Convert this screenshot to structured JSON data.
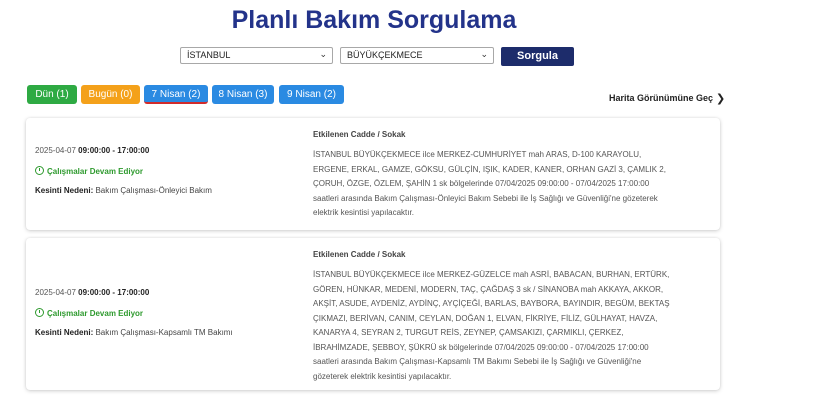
{
  "page": {
    "title": "Planlı Bakım Sorgulama"
  },
  "search": {
    "province": "İSTANBUL",
    "district": "BÜYÜKÇEKMECE",
    "button_label": "Sorgula"
  },
  "tabs": [
    {
      "label": "Dün (1)",
      "color": "#2eaa43"
    },
    {
      "label": "Bugün (0)",
      "color": "#f4a11a"
    },
    {
      "label": "7 Nisan (2)",
      "color": "#2a8ae2",
      "active": true
    },
    {
      "label": "8 Nisan (3)",
      "color": "#2a8ae2"
    },
    {
      "label": "9 Nisan (2)",
      "color": "#2a8ae2"
    }
  ],
  "map_link": "Harita Görünümüne Geç",
  "labels": {
    "reason": "Kesinti Nedeni:",
    "affected": "Etkilenen Cadde / Sokak"
  },
  "outages": [
    {
      "date": "2025-04-07",
      "time": "09:00:00 - 17:00:00",
      "status": "Çalışmalar Devam Ediyor",
      "reason": "Bakım Çalışması-Önleyici Bakım",
      "affected": "İSTANBUL BÜYÜKÇEKMECE ilce MERKEZ-CUMHURİYET mah ARAS, D-100 KARAYOLU, ERGENE, ERKAL, GAMZE, GÖKSU, GÜLÇİN, IŞIK, KADER, KANER, ORHAN GAZİ 3, ÇAMLIK 2, ÇORUH, ÖZGE, ÖZLEM, ŞAHİN 1 sk bölgelerinde 07/04/2025 09:00:00 - 07/04/2025 17:00:00 saatleri arasında Bakım Çalışması-Önleyici Bakım Sebebi ile İş Sağlığı ve Güvenliği'ne gözeterek elektrik kesintisi yapılacaktır."
    },
    {
      "date": "2025-04-07",
      "time": "09:00:00 - 17:00:00",
      "status": "Çalışmalar Devam Ediyor",
      "reason": "Bakım Çalışması-Kapsamlı TM Bakımı",
      "affected": "İSTANBUL BÜYÜKÇEKMECE ilce MERKEZ-GÜZELCE mah ASRİ, BABACAN, BURHAN, ERTÜRK, GÖREN, HÜNKAR, MEDENİ, MODERN, TAÇ, ÇAĞDAŞ 3 sk / SİNANOBA mah AKKAYA, AKKOR, AKŞİT, ASUDE, AYDENİZ, AYDİNÇ, AYÇİÇEĞİ, BARLAS, BAYBORA, BAYINDIR, BEGÜM, BEKTAŞ ÇIKMAZI, BERİVAN, CANIM, CEYLAN, DOĞAN 1, ELVAN, FİKRİYE, FİLİZ, GÜLHAYAT, HAVZA, KANARYA 4, SEYRAN 2, TURGUT REİS, ZEYNEP, ÇAMSAKIZI, ÇARMIKLI, ÇERKEZ, İBRAHİMZADE, ŞEBBOY, ŞÜKRÜ sk bölgelerinde 07/04/2025 09:00:00 - 07/04/2025 17:00:00 saatleri arasında Bakım Çalışması-Kapsamlı TM Bakımı Sebebi ile İş Sağlığı ve Güvenliği'ne gözeterek elektrik kesintisi yapılacaktır."
    }
  ]
}
